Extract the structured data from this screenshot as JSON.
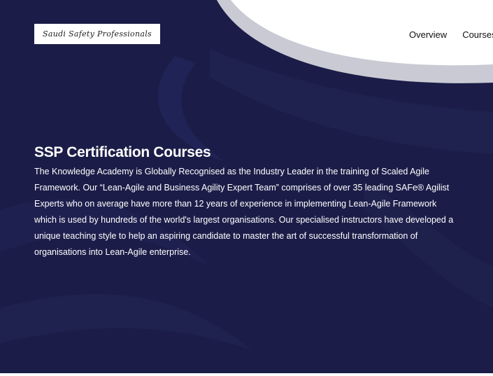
{
  "logo": {
    "text": "Saudi Safety Professionals"
  },
  "nav": {
    "items": [
      {
        "label": "Overview"
      },
      {
        "label": "Courses"
      }
    ]
  },
  "hero": {
    "title": "SSP Certification Courses",
    "description": "The Knowledge Academy is Globally Recognised as the Industry Leader in the training of Scaled Agile Framework. Our “Lean-Agile and Business Agility Expert Team” comprises of over 35 leading SAFe® Agilist Experts who on average have more than 12 years of experience in implementing Lean-Agile Framework which is used by hundreds of the world's largest organisations. Our specialised instructors have developed a unique teaching style to help an aspiring candidate to master the art of successful transformation of organisations into Lean-Agile enterprise."
  },
  "colors": {
    "hero_background": "#1b1d48",
    "arc_gray": "#c9cad3",
    "arc_white": "#ffffff",
    "text_light": "#ffffff",
    "nav_text": "#111111"
  }
}
